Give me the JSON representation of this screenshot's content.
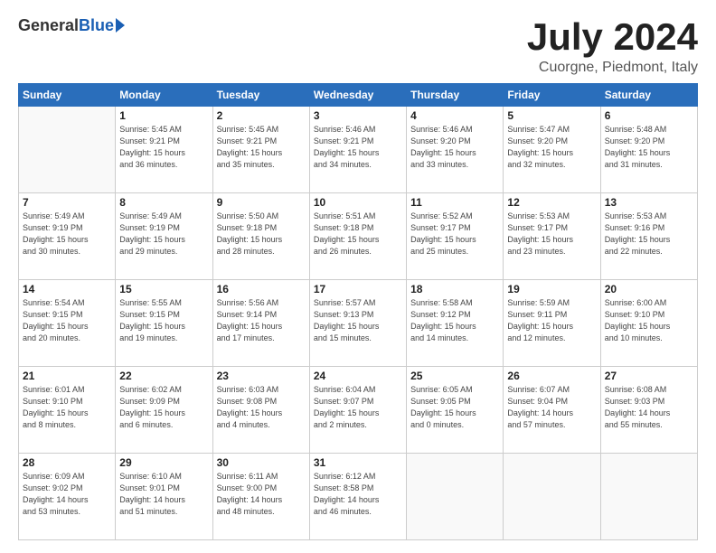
{
  "logo": {
    "general": "General",
    "blue": "Blue"
  },
  "title": "July 2024",
  "location": "Cuorgne, Piedmont, Italy",
  "weekdays": [
    "Sunday",
    "Monday",
    "Tuesday",
    "Wednesday",
    "Thursday",
    "Friday",
    "Saturday"
  ],
  "weeks": [
    [
      {
        "day": "",
        "info": ""
      },
      {
        "day": "1",
        "info": "Sunrise: 5:45 AM\nSunset: 9:21 PM\nDaylight: 15 hours\nand 36 minutes."
      },
      {
        "day": "2",
        "info": "Sunrise: 5:45 AM\nSunset: 9:21 PM\nDaylight: 15 hours\nand 35 minutes."
      },
      {
        "day": "3",
        "info": "Sunrise: 5:46 AM\nSunset: 9:21 PM\nDaylight: 15 hours\nand 34 minutes."
      },
      {
        "day": "4",
        "info": "Sunrise: 5:46 AM\nSunset: 9:20 PM\nDaylight: 15 hours\nand 33 minutes."
      },
      {
        "day": "5",
        "info": "Sunrise: 5:47 AM\nSunset: 9:20 PM\nDaylight: 15 hours\nand 32 minutes."
      },
      {
        "day": "6",
        "info": "Sunrise: 5:48 AM\nSunset: 9:20 PM\nDaylight: 15 hours\nand 31 minutes."
      }
    ],
    [
      {
        "day": "7",
        "info": "Sunrise: 5:49 AM\nSunset: 9:19 PM\nDaylight: 15 hours\nand 30 minutes."
      },
      {
        "day": "8",
        "info": "Sunrise: 5:49 AM\nSunset: 9:19 PM\nDaylight: 15 hours\nand 29 minutes."
      },
      {
        "day": "9",
        "info": "Sunrise: 5:50 AM\nSunset: 9:18 PM\nDaylight: 15 hours\nand 28 minutes."
      },
      {
        "day": "10",
        "info": "Sunrise: 5:51 AM\nSunset: 9:18 PM\nDaylight: 15 hours\nand 26 minutes."
      },
      {
        "day": "11",
        "info": "Sunrise: 5:52 AM\nSunset: 9:17 PM\nDaylight: 15 hours\nand 25 minutes."
      },
      {
        "day": "12",
        "info": "Sunrise: 5:53 AM\nSunset: 9:17 PM\nDaylight: 15 hours\nand 23 minutes."
      },
      {
        "day": "13",
        "info": "Sunrise: 5:53 AM\nSunset: 9:16 PM\nDaylight: 15 hours\nand 22 minutes."
      }
    ],
    [
      {
        "day": "14",
        "info": "Sunrise: 5:54 AM\nSunset: 9:15 PM\nDaylight: 15 hours\nand 20 minutes."
      },
      {
        "day": "15",
        "info": "Sunrise: 5:55 AM\nSunset: 9:15 PM\nDaylight: 15 hours\nand 19 minutes."
      },
      {
        "day": "16",
        "info": "Sunrise: 5:56 AM\nSunset: 9:14 PM\nDaylight: 15 hours\nand 17 minutes."
      },
      {
        "day": "17",
        "info": "Sunrise: 5:57 AM\nSunset: 9:13 PM\nDaylight: 15 hours\nand 15 minutes."
      },
      {
        "day": "18",
        "info": "Sunrise: 5:58 AM\nSunset: 9:12 PM\nDaylight: 15 hours\nand 14 minutes."
      },
      {
        "day": "19",
        "info": "Sunrise: 5:59 AM\nSunset: 9:11 PM\nDaylight: 15 hours\nand 12 minutes."
      },
      {
        "day": "20",
        "info": "Sunrise: 6:00 AM\nSunset: 9:10 PM\nDaylight: 15 hours\nand 10 minutes."
      }
    ],
    [
      {
        "day": "21",
        "info": "Sunrise: 6:01 AM\nSunset: 9:10 PM\nDaylight: 15 hours\nand 8 minutes."
      },
      {
        "day": "22",
        "info": "Sunrise: 6:02 AM\nSunset: 9:09 PM\nDaylight: 15 hours\nand 6 minutes."
      },
      {
        "day": "23",
        "info": "Sunrise: 6:03 AM\nSunset: 9:08 PM\nDaylight: 15 hours\nand 4 minutes."
      },
      {
        "day": "24",
        "info": "Sunrise: 6:04 AM\nSunset: 9:07 PM\nDaylight: 15 hours\nand 2 minutes."
      },
      {
        "day": "25",
        "info": "Sunrise: 6:05 AM\nSunset: 9:05 PM\nDaylight: 15 hours\nand 0 minutes."
      },
      {
        "day": "26",
        "info": "Sunrise: 6:07 AM\nSunset: 9:04 PM\nDaylight: 14 hours\nand 57 minutes."
      },
      {
        "day": "27",
        "info": "Sunrise: 6:08 AM\nSunset: 9:03 PM\nDaylight: 14 hours\nand 55 minutes."
      }
    ],
    [
      {
        "day": "28",
        "info": "Sunrise: 6:09 AM\nSunset: 9:02 PM\nDaylight: 14 hours\nand 53 minutes."
      },
      {
        "day": "29",
        "info": "Sunrise: 6:10 AM\nSunset: 9:01 PM\nDaylight: 14 hours\nand 51 minutes."
      },
      {
        "day": "30",
        "info": "Sunrise: 6:11 AM\nSunset: 9:00 PM\nDaylight: 14 hours\nand 48 minutes."
      },
      {
        "day": "31",
        "info": "Sunrise: 6:12 AM\nSunset: 8:58 PM\nDaylight: 14 hours\nand 46 minutes."
      },
      {
        "day": "",
        "info": ""
      },
      {
        "day": "",
        "info": ""
      },
      {
        "day": "",
        "info": ""
      }
    ]
  ]
}
